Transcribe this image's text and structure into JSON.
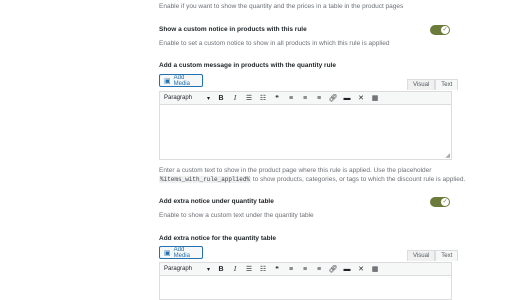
{
  "sections": {
    "top_desc": "Enable if you want to show the quantity and the prices in a table in the product pages",
    "custom_notice": {
      "label": "Show a custom notice in products with this rule",
      "desc": "Enable to set a custom notice to show in all products in which this rule is applied",
      "toggle_on": true
    },
    "custom_message": {
      "label": "Add a custom message in products with the quantity rule",
      "add_media": "Add Media",
      "tab_visual": "Visual",
      "tab_text": "Text",
      "format": "Paragraph",
      "help_before": "Enter a custom text to show in the product page where this rule is applied. Use the placeholder",
      "placeholder_code": "%items_with_rule_applied%",
      "help_after": "to show products, categories, or tags to which the discount rule is applied."
    },
    "extra_notice": {
      "label": "Add extra notice under quantity table",
      "desc": "Enable to show a custom text under the quantity table",
      "toggle_on": true
    },
    "extra_notice_editor": {
      "label": "Add extra notice for the quantity table",
      "add_media": "Add Media",
      "tab_visual": "Visual",
      "tab_text": "Text",
      "format": "Paragraph"
    }
  },
  "icons": {
    "toolbar": [
      "bold-icon",
      "italic-icon",
      "bullet-list-icon",
      "numbered-list-icon",
      "blockquote-icon",
      "align-left-icon",
      "align-center-icon",
      "align-right-icon",
      "link-icon",
      "read-more-icon",
      "fullscreen-icon",
      "toolbar-toggle-icon"
    ]
  },
  "colors": {
    "toggle_on": "#6c7a3a",
    "link_blue": "#2271b1"
  }
}
